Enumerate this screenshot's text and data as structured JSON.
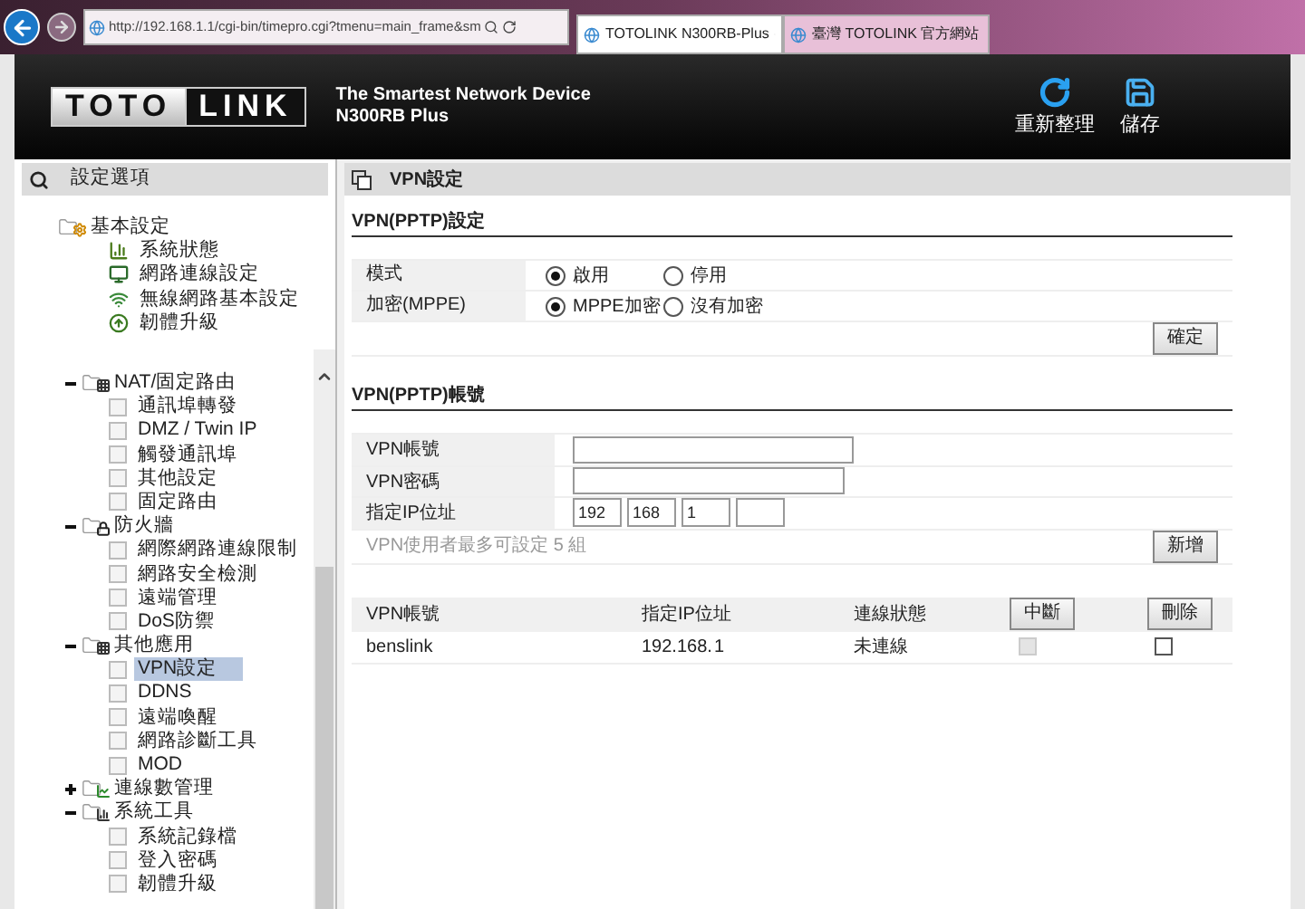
{
  "browser": {
    "address": "http://192.168.1.1/cgi-bin/timepro.cgi?tmenu=main_frame&sm",
    "tabs": [
      {
        "title": "TOTOLINK N300RB-Plus",
        "selected": true
      },
      {
        "title": "臺灣 TOTOLINK 官方網站",
        "selected": false
      }
    ]
  },
  "header": {
    "logo_left": "TOTO",
    "logo_right": "LINK",
    "tagline": "The Smartest Network Device",
    "model": "N300RB Plus",
    "actions": [
      {
        "label": "重新整理",
        "kind": "refresh"
      },
      {
        "label": "儲存",
        "kind": "save"
      }
    ]
  },
  "sidebar": {
    "title": "設定選項",
    "tree": [
      {
        "label": "基本設定",
        "kind": "basic",
        "children": [
          {
            "label": "系統狀態",
            "kind": "status",
            "selected": false
          },
          {
            "label": "網路連線設定",
            "kind": "network",
            "selected": false
          },
          {
            "label": "無線網路基本設定",
            "kind": "wireless",
            "selected": false
          },
          {
            "label": "韌體升級",
            "kind": "upgrade",
            "selected": false
          }
        ]
      }
    ],
    "scroll_tree": [
      {
        "label": "NAT/固定路由",
        "kind": "nat",
        "expanded": true,
        "children": [
          {
            "label": "通訊埠轉發",
            "kind": "page",
            "selected": false
          },
          {
            "label": "DMZ / Twin IP",
            "kind": "page",
            "selected": false
          },
          {
            "label": "觸發通訊埠",
            "kind": "page",
            "selected": false
          },
          {
            "label": "其他設定",
            "kind": "page",
            "selected": false
          },
          {
            "label": "固定路由",
            "kind": "page",
            "selected": false
          }
        ]
      },
      {
        "label": "防火牆",
        "kind": "firewall",
        "expanded": true,
        "children": [
          {
            "label": "網際網路連線限制",
            "kind": "page",
            "selected": false
          },
          {
            "label": "網路安全檢測",
            "kind": "page",
            "selected": false
          },
          {
            "label": "遠端管理",
            "kind": "page",
            "selected": false
          },
          {
            "label": "DoS防禦",
            "kind": "page",
            "selected": false
          }
        ]
      },
      {
        "label": "其他應用",
        "kind": "apps",
        "expanded": true,
        "children": [
          {
            "label": "VPN設定",
            "kind": "page",
            "selected": true
          },
          {
            "label": "DDNS",
            "kind": "page",
            "selected": false
          },
          {
            "label": "遠端喚醒",
            "kind": "page",
            "selected": false
          },
          {
            "label": "網路診斷工具",
            "kind": "page",
            "selected": false
          },
          {
            "label": "MOD",
            "kind": "page",
            "selected": false
          }
        ]
      },
      {
        "label": "連線數管理",
        "kind": "sessions",
        "expanded": false
      },
      {
        "label": "系統工具",
        "kind": "tools",
        "expanded": true,
        "children": [
          {
            "label": "系統記錄檔",
            "kind": "page",
            "selected": false
          },
          {
            "label": "登入密碼",
            "kind": "page",
            "selected": false
          },
          {
            "label": "韌體升級",
            "kind": "page",
            "selected": false
          }
        ]
      }
    ]
  },
  "content": {
    "title": "VPN設定",
    "pptp_settings": {
      "heading": "VPN(PPTP)設定",
      "rows": [
        {
          "label": "模式",
          "options": [
            {
              "label": "啟用",
              "selected": true
            },
            {
              "label": "停用",
              "selected": false
            }
          ]
        },
        {
          "label": "加密(MPPE)",
          "options": [
            {
              "label": "MPPE加密",
              "selected": true
            },
            {
              "label": "沒有加密",
              "selected": false
            }
          ]
        }
      ],
      "button": "確定"
    },
    "accounts": {
      "heading": "VPN(PPTP)帳號",
      "fields": [
        {
          "label": "VPN帳號",
          "kind": "text"
        },
        {
          "label": "VPN密碼",
          "kind": "text"
        },
        {
          "label": "指定IP位址",
          "kind": "ip",
          "octets": [
            "192",
            "168",
            "1"
          ]
        }
      ],
      "note": "VPN使用者最多可設定 5 組",
      "button": "新增"
    },
    "table": {
      "columns": [
        "VPN帳號",
        "指定IP位址",
        "連線狀態"
      ],
      "disconnect_button": "中斷",
      "delete_button": "刪除",
      "rows": [
        {
          "account": "benslink",
          "ip_prefix": "192.168.",
          "ip_suffix": "1",
          "status": "未連線",
          "disconnect_checked": false,
          "disconnect_disabled": true,
          "delete_checked": false
        }
      ]
    }
  }
}
